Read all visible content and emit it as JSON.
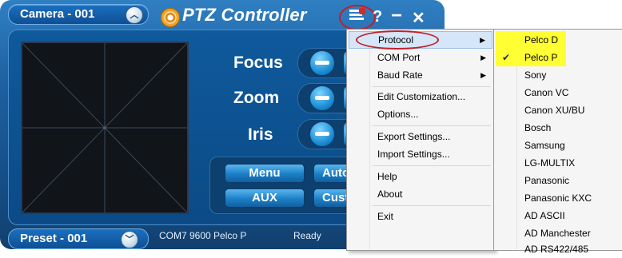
{
  "app": {
    "title": "PTZ Controller",
    "camera": "Camera - 001",
    "preset": "Preset - 001",
    "help_icon": "?",
    "minimize_icon": "−",
    "close_icon": "✕",
    "controls": [
      "Focus",
      "Zoom",
      "Iris"
    ],
    "buttons": {
      "menu": "Menu",
      "aux": "AUX",
      "auto": "Auto",
      "cust": "Cust"
    },
    "status": {
      "port": "COM7 9600 Pelco P",
      "state": "Ready"
    }
  },
  "menu": {
    "items": {
      "protocol": "Protocol",
      "com_port": "COM Port",
      "baud_rate": "Baud Rate",
      "edit_customization": "Edit Customization...",
      "options": "Options...",
      "export_settings": "Export Settings...",
      "import_settings": "Import Settings...",
      "help": "Help",
      "about": "About",
      "exit": "Exit"
    },
    "arrow": "▶"
  },
  "submenu": {
    "check_glyph": "✔",
    "items": [
      "Pelco D",
      "Pelco P",
      "Sony",
      "Canon VC",
      "Canon XU/BU",
      "Bosch",
      "Samsung",
      "LG-MULTIX",
      "Panasonic",
      "Panasonic KXC",
      "AD ASCII",
      "AD Manchester",
      "AD RS422/485"
    ]
  },
  "colors": {
    "highlight_yellow": "#ffff33",
    "annotation_red": "#c0202a",
    "menu_highlight": "#d5e6f8"
  }
}
